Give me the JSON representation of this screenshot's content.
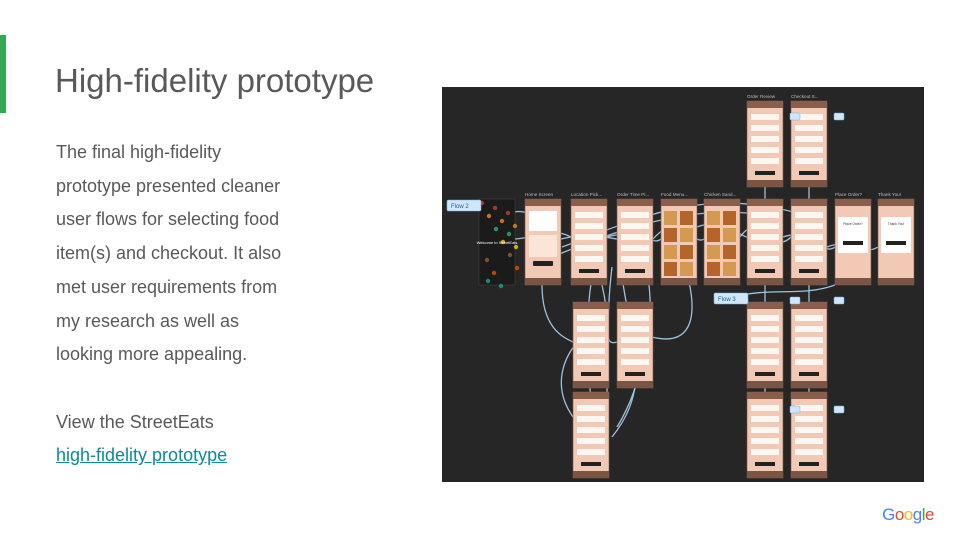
{
  "slide": {
    "title": "High-fidelity prototype",
    "paragraph_lines": [
      "The final high-fidelity",
      "prototype presented cleaner",
      "user flows for selecting food",
      "item(s) and checkout. It also",
      "met user requirements from",
      "my research as well as",
      "looking more appealing."
    ],
    "view_text": "View the StreetEats",
    "link_text": "high-fidelity prototype",
    "accent_color": "#34a853",
    "link_color": "#0b8a9a"
  },
  "prototype": {
    "flow_labels": [
      "Flow 2",
      "Flow 3"
    ],
    "screen_titles": [
      "Order Review",
      "Checkout S...",
      "iPhone 14 - 2",
      "Home Screen",
      "Location Pick...",
      "Order Time Pi...",
      "Food Menu...",
      "Chicken Sand...",
      "Place Order?",
      "Thank You!"
    ],
    "welcome_text": "Welcome to StreetEats",
    "order_now_label": "Order Now",
    "place_order_text": "Place Order?",
    "thank_you_text": "Thank You!"
  },
  "logo": {
    "letters": [
      "G",
      "o",
      "o",
      "g",
      "l",
      "e"
    ],
    "colors": [
      "#4285f4",
      "#ea4335",
      "#fbbc05",
      "#4285f4",
      "#34a853",
      "#ea4335"
    ]
  }
}
